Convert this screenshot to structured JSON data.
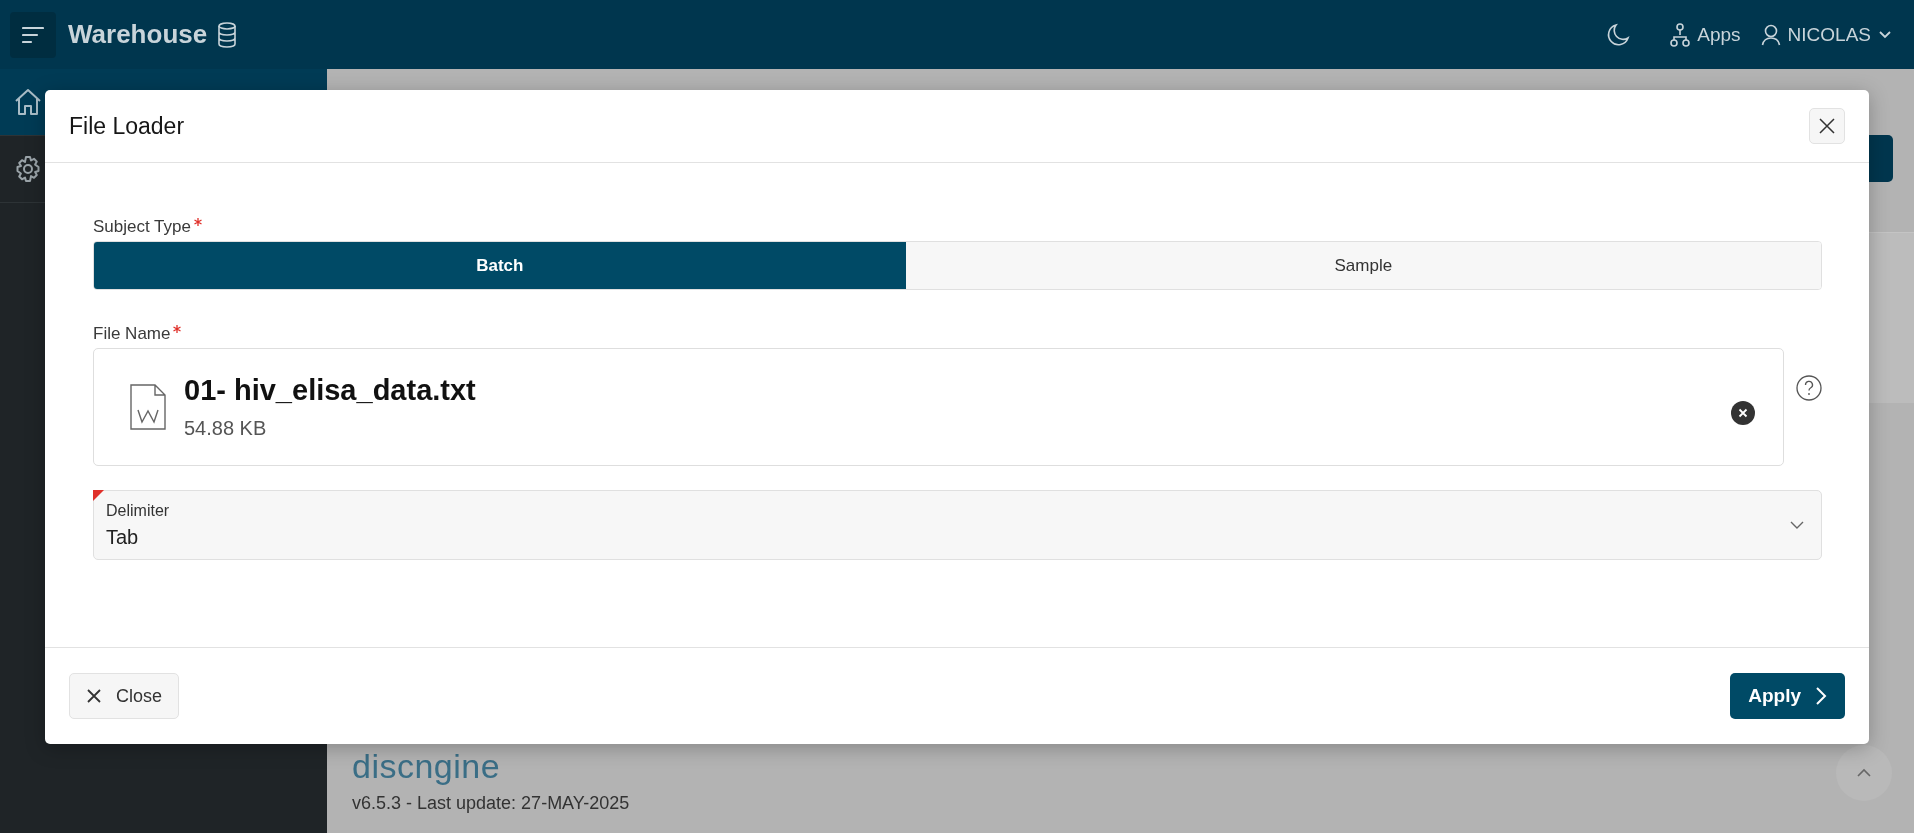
{
  "header": {
    "app_title": "Warehouse",
    "apps_label": "Apps",
    "user_name": "NICOLAS"
  },
  "sidebar": {
    "items": [
      {
        "kind": "home",
        "selected": true
      },
      {
        "kind": "settings",
        "selected": false
      }
    ]
  },
  "page_footer": {
    "logo": "discngine",
    "version": "v6.5.3 - Last update: 27-MAY-2025"
  },
  "dialog": {
    "title": "File Loader",
    "subject_type": {
      "label": "Subject Type",
      "required": true,
      "options": [
        {
          "label": "Batch",
          "selected": true
        },
        {
          "label": "Sample",
          "selected": false
        }
      ]
    },
    "file_name": {
      "label": "File Name",
      "required": true,
      "file": "01- hiv_elisa_data.txt",
      "size": "54.88 KB"
    },
    "delimiter": {
      "label": "Delimiter",
      "value": "Tab",
      "required": true
    },
    "buttons": {
      "close": "Close",
      "apply": "Apply"
    }
  }
}
